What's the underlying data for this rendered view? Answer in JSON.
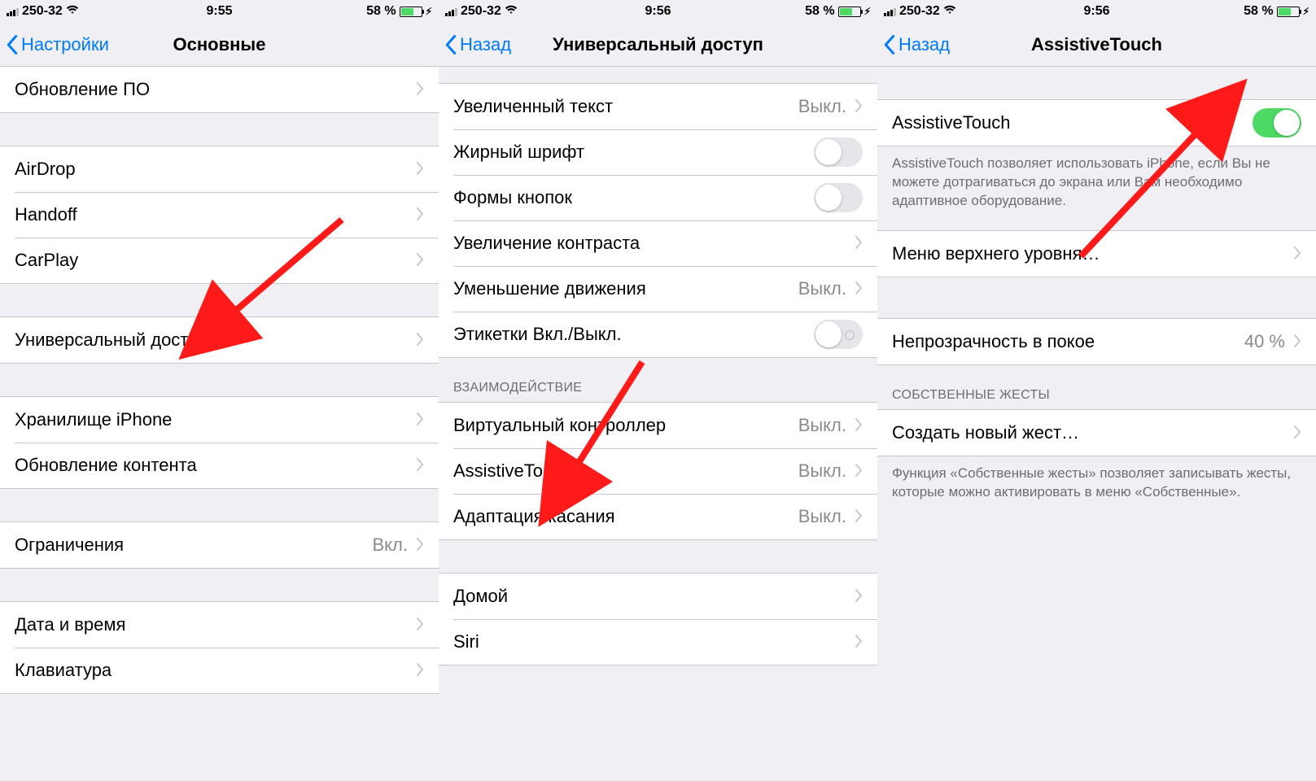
{
  "status": {
    "carrier": "250-32",
    "battery_pct": "58 %"
  },
  "screen1": {
    "time": "9:55",
    "back": "Настройки",
    "title": "Основные",
    "rows": {
      "software_update": "Обновление ПО",
      "airdrop": "AirDrop",
      "handoff": "Handoff",
      "carplay": "CarPlay",
      "accessibility": "Универсальный доступ",
      "storage": "Хранилище iPhone",
      "background_refresh": "Обновление контента",
      "restrictions": "Ограничения",
      "restrictions_val": "Вкл.",
      "datetime": "Дата и время",
      "keyboard": "Клавиатура"
    }
  },
  "screen2": {
    "time": "9:56",
    "back": "Назад",
    "title": "Универсальный доступ",
    "rows": {
      "larger_text": "Увеличенный текст",
      "larger_text_val": "Выкл.",
      "bold_text": "Жирный шрифт",
      "button_shapes": "Формы кнопок",
      "increase_contrast": "Увеличение контраста",
      "reduce_motion": "Уменьшение движения",
      "reduce_motion_val": "Выкл.",
      "onoff_labels": "Этикетки Вкл./Выкл.",
      "section_interaction": "ВЗАИМОДЕЙСТВИЕ",
      "switch_control": "Виртуальный контроллер",
      "switch_control_val": "Выкл.",
      "assistive_touch": "AssistiveTouch",
      "assistive_touch_val": "Выкл.",
      "touch_accommodations": "Адаптация касания",
      "touch_accommodations_val": "Выкл.",
      "home": "Домой",
      "siri": "Siri"
    }
  },
  "screen3": {
    "time": "9:56",
    "back": "Назад",
    "title": "AssistiveTouch",
    "rows": {
      "assistive_touch": "AssistiveTouch",
      "footer1": "AssistiveTouch позволяет использовать iPhone, если Вы не можете дотрагиваться до экрана или Вам необходимо адаптивное оборудование.",
      "top_menu": "Меню верхнего уровня…",
      "idle_opacity": "Непрозрачность в покое",
      "idle_opacity_val": "40 %",
      "section_custom": "СОБСТВЕННЫЕ ЖЕСТЫ",
      "create_gesture": "Создать новый жест…",
      "footer2": "Функция «Собственные жесты» позволяет записывать жесты, которые можно активировать в меню «Собственные»."
    }
  }
}
